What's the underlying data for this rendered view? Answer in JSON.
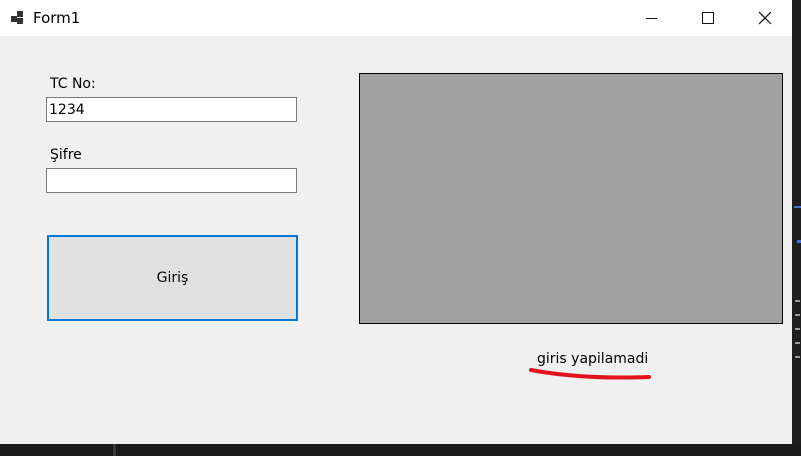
{
  "window": {
    "title": "Form1"
  },
  "form": {
    "tc_label": "TC No:",
    "tc_value": "1234",
    "password_label": "Şifre",
    "password_value": "",
    "login_button": "Giriş",
    "status_text": "giris yapilamadi"
  },
  "colors": {
    "window_bg": "#f0f0f0",
    "picture_bg": "#a0a0a0",
    "button_border": "#0078d7",
    "annotation": "#e0141b"
  },
  "icons": {
    "app": "app-window-icon",
    "minimize": "minimize-icon",
    "maximize": "maximize-icon",
    "close": "close-icon"
  }
}
